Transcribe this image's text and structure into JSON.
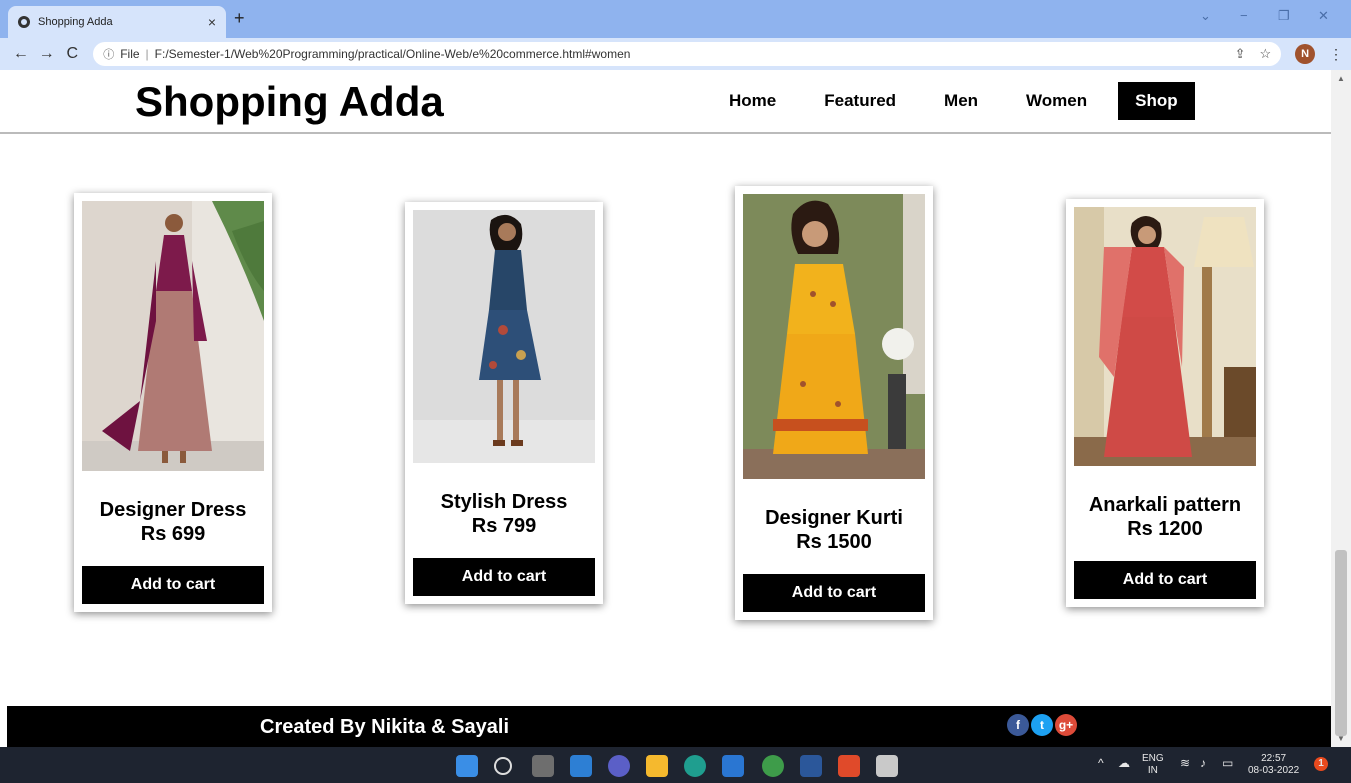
{
  "browser": {
    "tab_title": "Shopping Adda",
    "tab_close": "×",
    "new_tab": "+",
    "url_info": "ⓘ",
    "url_scheme": "File",
    "url": "F:/Semester-1/Web%20Programming/practical/Online-Web/e%20commerce.html#women",
    "profile_initial": "N",
    "back": "←",
    "forward": "→",
    "reload": "C",
    "minimize": "−",
    "restore": "❐",
    "close": "✕",
    "dropdown": "⌄",
    "share": "⇪",
    "star": "☆",
    "kebab": "⋮"
  },
  "site": {
    "logo": "Shopping Adda",
    "nav": [
      "Home",
      "Featured",
      "Men",
      "Women",
      "Shop"
    ],
    "active_nav": "Shop"
  },
  "products": [
    {
      "name": "Designer Dress",
      "price": "Rs 699",
      "button": "Add to cart"
    },
    {
      "name": "Stylish Dress",
      "price": "Rs 799",
      "button": "Add to cart"
    },
    {
      "name": "Designer Kurti",
      "price": "Rs 1500",
      "button": "Add to cart"
    },
    {
      "name": "Anarkali pattern",
      "price": "Rs 1200",
      "button": "Add to cart"
    }
  ],
  "footer": {
    "credit": "Created By Nikita & Sayali",
    "social": [
      {
        "label": "f",
        "color": "#3b5998"
      },
      {
        "label": "t",
        "color": "#1da1f2"
      },
      {
        "label": "g+",
        "color": "#dd4b39"
      }
    ]
  },
  "taskbar": {
    "language_top": "ENG",
    "language_bottom": "IN",
    "time": "22:57",
    "date": "08-03-2022",
    "notification_count": "1"
  }
}
